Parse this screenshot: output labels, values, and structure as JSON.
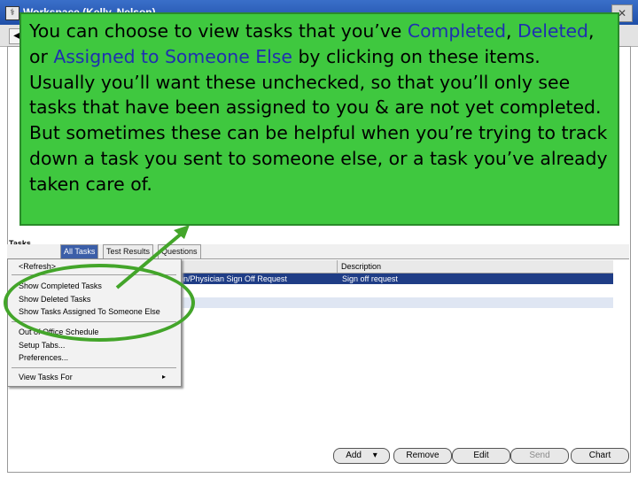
{
  "window": {
    "title": "Workspace (Kelly, Nelson)",
    "icon": "app-icon",
    "close": "✕"
  },
  "toolbar": {
    "buttons": [
      "◀",
      "▶",
      "▦"
    ]
  },
  "tabs": {
    "label": "Tasks",
    "items": [
      {
        "label": "All Tasks",
        "active": true
      },
      {
        "label": "Test Results",
        "active": false
      },
      {
        "label": "Questions",
        "active": false
      }
    ]
  },
  "grid": {
    "columns": [
      "",
      "Description"
    ],
    "rows": [
      {
        "col1": "on/Physician Sign Off Request",
        "col2": "Sign off request",
        "selected": true
      },
      {
        "col1": "",
        "col2": "",
        "selected": false
      }
    ]
  },
  "menu": {
    "items": [
      {
        "label": "<Refresh>"
      },
      {
        "label": "Show Completed Tasks"
      },
      {
        "label": "Show Deleted Tasks"
      },
      {
        "label": "Show Tasks Assigned To Someone Else"
      },
      {
        "label": "Out of Office Schedule"
      },
      {
        "label": "Setup Tabs..."
      },
      {
        "label": "Preferences..."
      },
      {
        "label": "View Tasks For",
        "submenu": "▸"
      }
    ]
  },
  "actions": {
    "add": "Add",
    "add_arrow": "▾",
    "remove": "Remove",
    "edit": "Edit",
    "send": "Send",
    "chart": "Chart"
  },
  "callout": {
    "p1_a": "You can choose to view tasks that you’ve ",
    "p1_completed": "Completed",
    "p1_b": ", ",
    "p1_deleted": "Deleted",
    "p1_c": ", or ",
    "p1_assigned": "Assigned to Someone Else",
    "p1_d": " by clicking on these items.",
    "p2": "Usually you’ll want these unchecked, so that you’ll only see tasks that have been assigned to you & are not yet completed.  But sometimes these can be helpful when you’re trying to track down a task you sent to someone else, or a task you’ve already taken care of."
  },
  "colors": {
    "callout_bg": "#3fc83f",
    "highlight_ring": "#43a52a",
    "selected_row": "#1f3d86",
    "link_blue": "#1f2fb0"
  }
}
